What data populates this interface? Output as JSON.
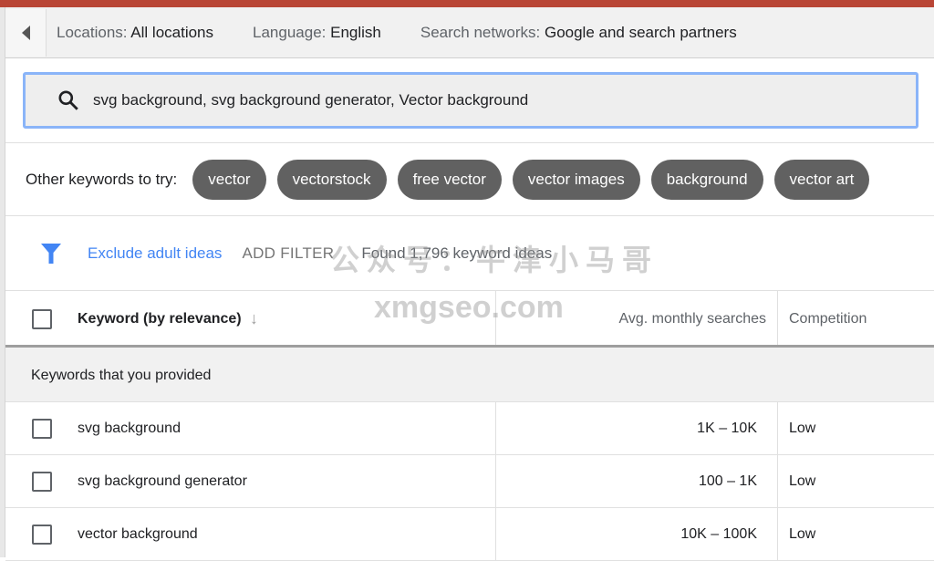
{
  "header": {
    "locations_label": "Locations:",
    "locations_value": "All locations",
    "language_label": "Language:",
    "language_value": "English",
    "networks_label": "Search networks:",
    "networks_value": "Google and search partners"
  },
  "search": {
    "value": "svg background, svg background generator, Vector background"
  },
  "suggestions": {
    "label": "Other keywords to try:",
    "chips": [
      "vector",
      "vectorstock",
      "free vector",
      "vector images",
      "background",
      "vector art"
    ]
  },
  "filter": {
    "exclude_label": "Exclude adult ideas",
    "add_filter_label": "ADD FILTER",
    "found_text": "Found 1,796 keyword ideas"
  },
  "table": {
    "columns": {
      "keyword": "Keyword (by relevance)",
      "avg": "Avg. monthly searches",
      "competition": "Competition"
    },
    "section_label": "Keywords that you provided",
    "rows": [
      {
        "keyword": "svg background",
        "avg": "1K – 10K",
        "competition": "Low"
      },
      {
        "keyword": "svg background generator",
        "avg": "100 – 1K",
        "competition": "Low"
      },
      {
        "keyword": "vector background",
        "avg": "10K – 100K",
        "competition": "Low"
      }
    ]
  },
  "watermark": {
    "line1": "公众号：牛津小马哥",
    "line2": "xmgseo.com"
  },
  "colors": {
    "accent": "#4285f4",
    "chip": "#616161",
    "topbar": "#b94535"
  }
}
